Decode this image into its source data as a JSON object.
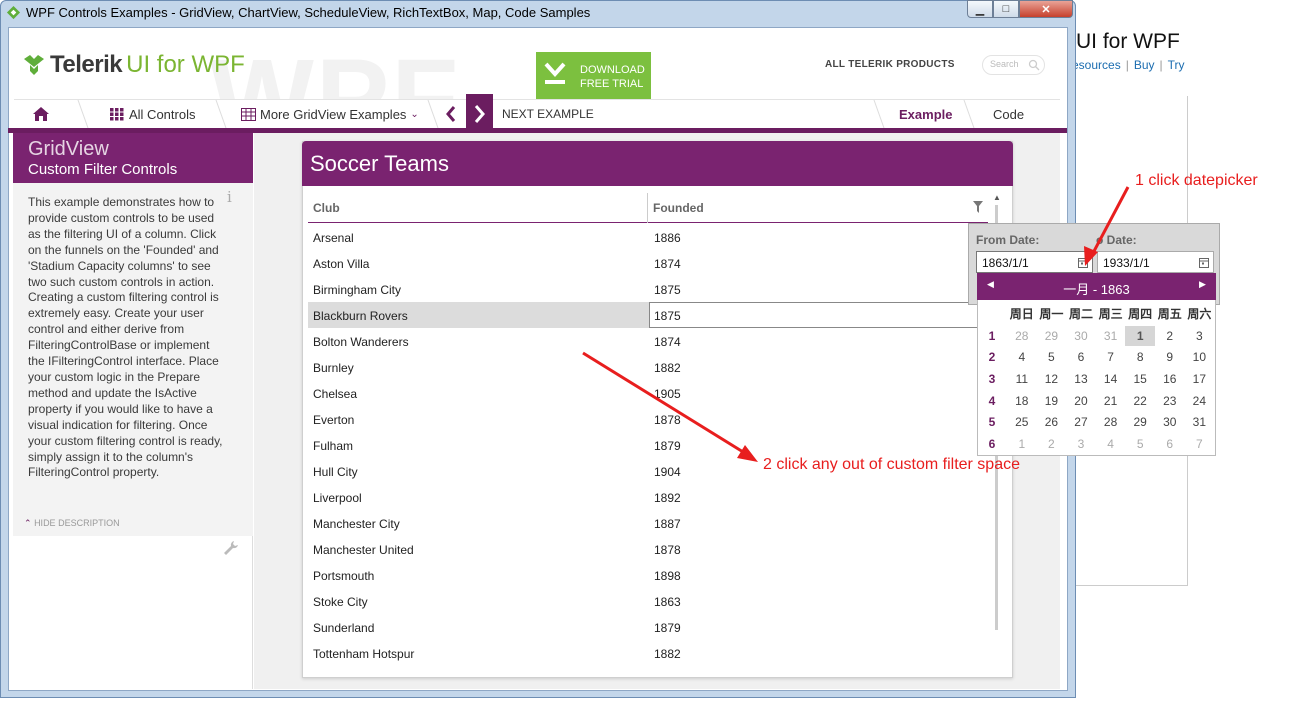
{
  "window": {
    "title": "WPF Controls Examples - GridView, ChartView, ScheduleView, RichTextBox, Map, Code Samples"
  },
  "background_page": {
    "title": "UI for WPF",
    "links": [
      "esources",
      "Buy",
      "Try"
    ]
  },
  "header": {
    "logo_brand": "Telerik",
    "logo_product": "UI for WPF",
    "download_line1": "DOWNLOAD",
    "download_line2": "FREE TRIAL",
    "all_products": "ALL TELERIK PRODUCTS",
    "search_placeholder": "Search"
  },
  "nav": {
    "all_controls": "All Controls",
    "more_examples": "More GridView Examples",
    "next_example": "NEXT EXAMPLE",
    "tab_example": "Example",
    "tab_code": "Code"
  },
  "sidebar": {
    "title": "GridView",
    "subtitle": "Custom Filter Controls",
    "description": "This example demonstrates how to provide custom controls to be used as the filtering UI of a column. Click on the funnels on the 'Founded' and 'Stadium Capacity columns' to see two such custom controls in action. Creating a custom filtering control is extremely easy. Create your user control and either derive from FilteringControlBase or implement the IFilteringControl interface. Place your custom logic in the Prepare method and update the IsActive property if you would like to have a visual indication for filtering. Once your custom filtering control is ready, simply assign it to the column's FilteringControl property.",
    "hide_description": "HIDE DESCRIPTION"
  },
  "grid": {
    "title": "Soccer Teams",
    "columns": [
      "Club",
      "Founded"
    ],
    "rows": [
      {
        "club": "Arsenal",
        "founded": "1886"
      },
      {
        "club": "Aston Villa",
        "founded": "1874"
      },
      {
        "club": "Birmingham City",
        "founded": "1875"
      },
      {
        "club": "Blackburn Rovers",
        "founded": "1875"
      },
      {
        "club": "Bolton Wanderers",
        "founded": "1874"
      },
      {
        "club": "Burnley",
        "founded": "1882"
      },
      {
        "club": "Chelsea",
        "founded": "1905"
      },
      {
        "club": "Everton",
        "founded": "1878"
      },
      {
        "club": "Fulham",
        "founded": "1879"
      },
      {
        "club": "Hull City",
        "founded": "1904"
      },
      {
        "club": "Liverpool",
        "founded": "1892"
      },
      {
        "club": "Manchester City",
        "founded": "1887"
      },
      {
        "club": "Manchester United",
        "founded": "1878"
      },
      {
        "club": "Portsmouth",
        "founded": "1898"
      },
      {
        "club": "Stoke City",
        "founded": "1863"
      },
      {
        "club": "Sunderland",
        "founded": "1879"
      },
      {
        "club": "Tottenham Hotspur",
        "founded": "1882"
      }
    ],
    "selected_row": 3
  },
  "filter_popup": {
    "from_label": "From Date:",
    "to_label": "o Date:",
    "from_value": "1863/1/1",
    "to_value": "1933/1/1",
    "calendar": {
      "title": "一月 - 1863",
      "days_of_week": [
        "周日",
        "周一",
        "周二",
        "周三",
        "周四",
        "周五",
        "周六"
      ],
      "weeks": [
        {
          "num": "1",
          "days": [
            "28",
            "29",
            "30",
            "31",
            "1",
            "2",
            "3"
          ]
        },
        {
          "num": "2",
          "days": [
            "4",
            "5",
            "6",
            "7",
            "8",
            "9",
            "10"
          ]
        },
        {
          "num": "3",
          "days": [
            "11",
            "12",
            "13",
            "14",
            "15",
            "16",
            "17"
          ]
        },
        {
          "num": "4",
          "days": [
            "18",
            "19",
            "20",
            "21",
            "22",
            "23",
            "24"
          ]
        },
        {
          "num": "5",
          "days": [
            "25",
            "26",
            "27",
            "28",
            "29",
            "30",
            "31"
          ]
        },
        {
          "num": "6",
          "days": [
            "1",
            "2",
            "3",
            "4",
            "5",
            "6",
            "7"
          ]
        }
      ],
      "selected_day": "1"
    }
  },
  "annotations": {
    "step1": "1 click datepicker",
    "step2": "2 click any out of custom filter space"
  },
  "colors": {
    "accent": "#7a2370",
    "download": "#7cc03f",
    "annotation": "#e81e1e"
  }
}
